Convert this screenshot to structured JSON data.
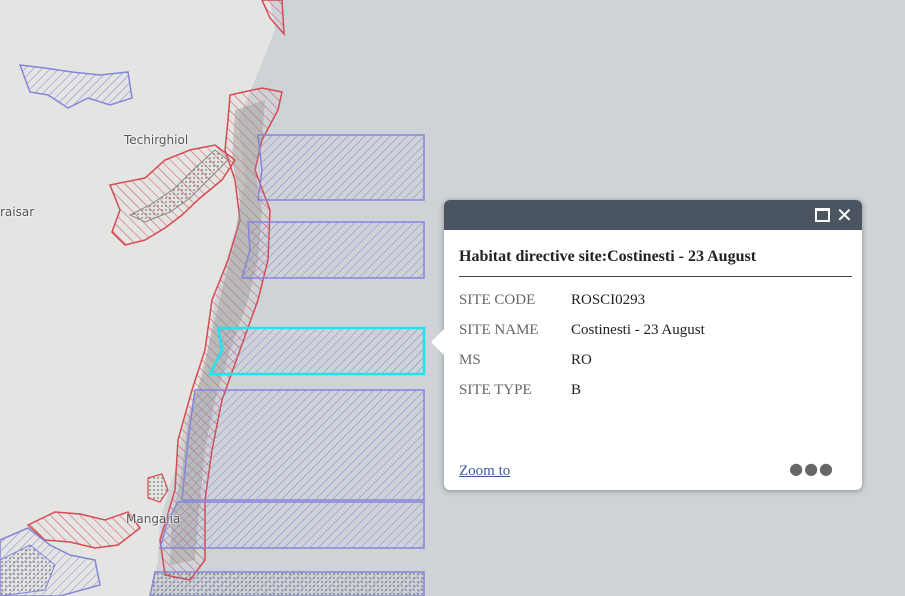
{
  "map": {
    "places": [
      "Techirghiol",
      "raisar",
      "Mangalia"
    ],
    "colors": {
      "land": "#e4e4e2",
      "sea": "#ced3d7",
      "habitat_site": "#d64a55",
      "bird_site": "#8585d9",
      "highlight": "#1ee4ee"
    }
  },
  "popup": {
    "title": "Habitat directive site:Costinesti - 23 August",
    "fields": [
      {
        "key": "SITE CODE",
        "value": "ROSCI0293"
      },
      {
        "key": "SITE NAME",
        "value": "Costinesti - 23 August"
      },
      {
        "key": "MS",
        "value": "RO"
      },
      {
        "key": "SITE TYPE",
        "value": "B"
      }
    ],
    "zoom_label": "Zoom to",
    "maximize_icon": "maximize-icon",
    "close_icon": "close-icon",
    "more_icon": "more-icon"
  }
}
